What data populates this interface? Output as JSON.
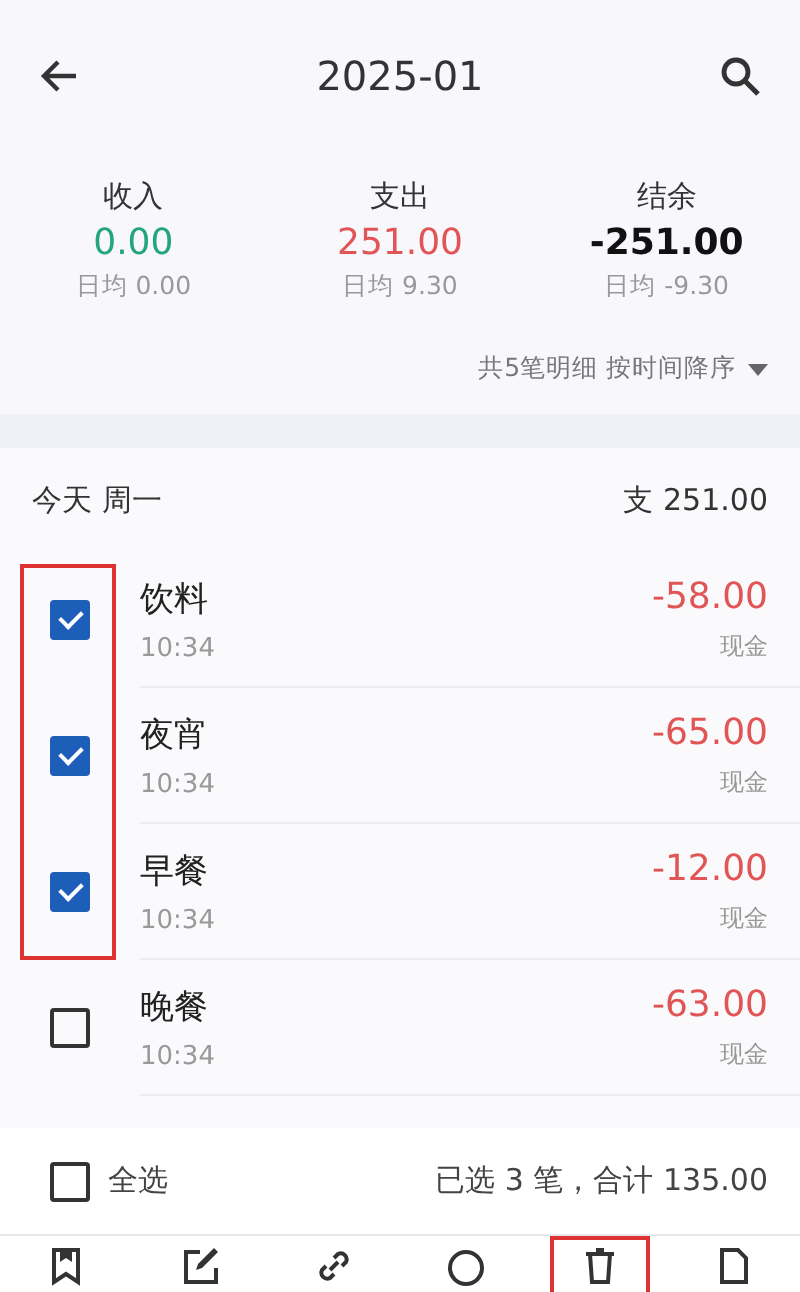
{
  "header": {
    "title": "2025-01"
  },
  "summary": [
    {
      "kind": "income",
      "label": "收入",
      "amount": "0.00",
      "daily": "日均 0.00"
    },
    {
      "kind": "expense",
      "label": "支出",
      "amount": "251.00",
      "daily": "日均 9.30"
    },
    {
      "kind": "balance",
      "label": "结余",
      "amount": "-251.00",
      "daily": "日均 -9.30"
    }
  ],
  "sort": {
    "text": "共5笔明细 按时间降序"
  },
  "day": {
    "title": "今天 周一",
    "total": "支 251.00"
  },
  "entries": [
    {
      "name": "饮料",
      "time": "10:34",
      "amount": "-58.00",
      "account": "现金",
      "checked": true,
      "highlighted": true
    },
    {
      "name": "夜宵",
      "time": "10:34",
      "amount": "-65.00",
      "account": "现金",
      "checked": true,
      "highlighted": true
    },
    {
      "name": "早餐",
      "time": "10:34",
      "amount": "-12.00",
      "account": "现金",
      "checked": true,
      "highlighted": true
    },
    {
      "name": "晚餐",
      "time": "10:34",
      "amount": "-63.00",
      "account": "现金",
      "checked": false,
      "highlighted": false
    }
  ],
  "select_all": {
    "label": "全选",
    "checked": false,
    "summary": "已选 3 笔，合计 135.00"
  },
  "toolbar": [
    {
      "kind": "bookmark",
      "highlighted": false
    },
    {
      "kind": "edit",
      "highlighted": false
    },
    {
      "kind": "link",
      "highlighted": false
    },
    {
      "kind": "circle",
      "highlighted": false
    },
    {
      "kind": "delete",
      "highlighted": true
    },
    {
      "kind": "file",
      "highlighted": false
    }
  ]
}
